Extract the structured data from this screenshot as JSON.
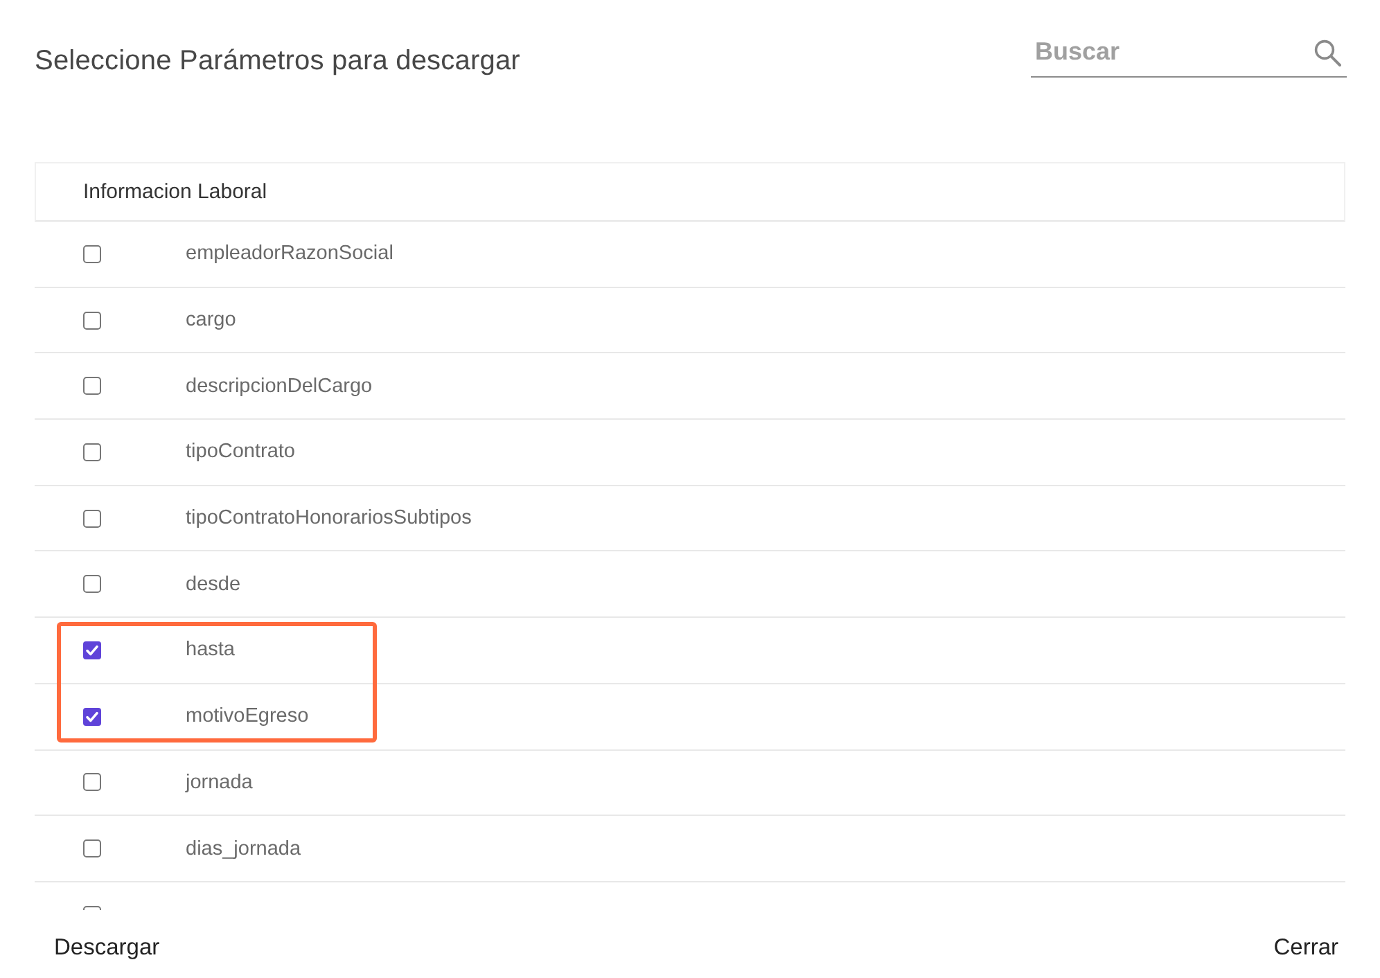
{
  "dialog": {
    "title": "Seleccione Parámetros para descargar"
  },
  "search": {
    "placeholder": "Buscar"
  },
  "list": {
    "heading": "Informacion Laboral",
    "items": [
      {
        "label": "empleadorRazonSocial",
        "checked": false,
        "highlighted": false
      },
      {
        "label": "cargo",
        "checked": false,
        "highlighted": false
      },
      {
        "label": "descripcionDelCargo",
        "checked": false,
        "highlighted": false
      },
      {
        "label": "tipoContrato",
        "checked": false,
        "highlighted": false
      },
      {
        "label": "tipoContratoHonorariosSubtipos",
        "checked": false,
        "highlighted": false
      },
      {
        "label": "desde",
        "checked": false,
        "highlighted": false
      },
      {
        "label": "hasta",
        "checked": true,
        "highlighted": true
      },
      {
        "label": "motivoEgreso",
        "checked": true,
        "highlighted": true
      },
      {
        "label": "jornada",
        "checked": false,
        "highlighted": false
      },
      {
        "label": "dias_jornada",
        "checked": false,
        "highlighted": false
      },
      {
        "checked": false,
        "highlighted": false
      }
    ]
  },
  "buttons": [
    {
      "label": "Descargar"
    },
    {
      "label": "Cerrar"
    }
  ]
}
